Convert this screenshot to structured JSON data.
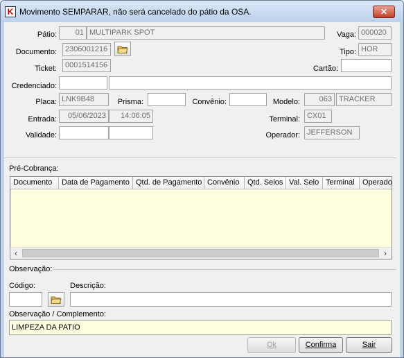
{
  "window": {
    "title": "Movimento SEMPARAR, não será cancelado do pátio da OSA.",
    "close_label": "✕"
  },
  "form": {
    "patio": {
      "label": "Pátio:",
      "code": "01",
      "name": "MULTIPARK SPOT"
    },
    "vaga": {
      "label": "Vaga:",
      "value": "000020"
    },
    "documento": {
      "label": "Documento:",
      "value": "2306001216"
    },
    "tipo": {
      "label": "Tipo:",
      "value": "HOR"
    },
    "ticket": {
      "label": "Ticket:",
      "value": "0001514156"
    },
    "cartao": {
      "label": "Cartão:",
      "value": ""
    },
    "credenciado": {
      "label": "Credenciado:",
      "code": "",
      "name": ""
    },
    "placa": {
      "label": "Placa:",
      "value": "LNK9B48"
    },
    "prisma": {
      "label": "Prisma:",
      "value": ""
    },
    "convenio": {
      "label": "Convênio:",
      "value": ""
    },
    "modelo": {
      "label": "Modelo:",
      "code": "063",
      "name": "TRACKER"
    },
    "entrada": {
      "label": "Entrada:",
      "date": "05/06/2023",
      "time": "14:06:05"
    },
    "terminal": {
      "label": "Terminal:",
      "value": "CX01"
    },
    "validade": {
      "label": "Validade:",
      "date": "",
      "time": ""
    },
    "operador": {
      "label": "Operador:",
      "value": "JEFFERSON"
    }
  },
  "pre_cobranca": {
    "label": "Pré-Cobrança:",
    "columns": [
      "Documento",
      "Data de Pagamento",
      "Qtd. de Pagamento",
      "Convênio",
      "Qtd. Selos",
      "Val. Selo",
      "Terminal",
      "Operador"
    ],
    "rows": []
  },
  "observacao": {
    "section_label": "Observação:",
    "codigo_label": "Código:",
    "codigo_value": "",
    "descricao_label": "Descrição:",
    "descricao_value": "",
    "complemento_label": "Observação / Complemento:",
    "complemento_value": "LIMPEZA DA PATIO"
  },
  "buttons": {
    "ok": {
      "label": "Ok",
      "enabled": false
    },
    "confirma": {
      "label": "Confirma"
    },
    "sair": {
      "label": "Sair"
    }
  },
  "icons": {
    "app": "app-logo-icon",
    "folder": "folder-icon",
    "close": "close-icon"
  }
}
